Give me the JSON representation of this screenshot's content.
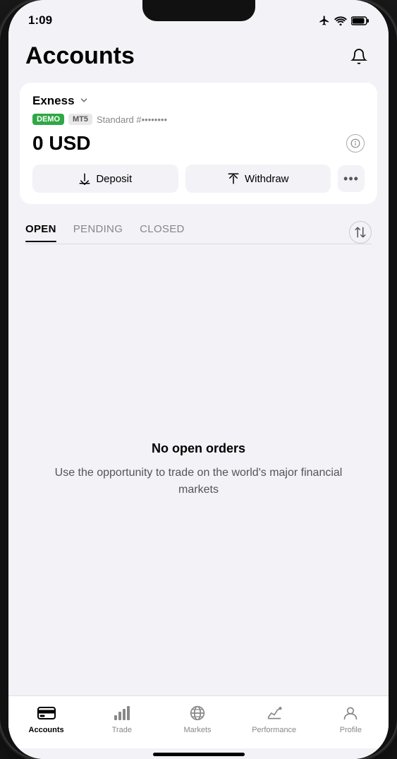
{
  "statusBar": {
    "time": "1:09",
    "icons": [
      "airplane",
      "wifi",
      "battery"
    ]
  },
  "header": {
    "title": "Accounts",
    "bellIcon": "bell"
  },
  "accountCard": {
    "brokerName": "Exness",
    "demoBadge": "DEMO",
    "mt5Badge": "MT5",
    "accountType": "Standard #••••••••",
    "balance": "0 USD",
    "depositLabel": "Deposit",
    "withdrawLabel": "Withdraw",
    "moreLabel": "•••"
  },
  "tabs": {
    "items": [
      {
        "label": "OPEN",
        "active": true
      },
      {
        "label": "PENDING",
        "active": false
      },
      {
        "label": "CLOSED",
        "active": false
      }
    ]
  },
  "emptyState": {
    "title": "No open orders",
    "subtitle": "Use the opportunity to trade on the world's major financial markets"
  },
  "bottomNav": {
    "items": [
      {
        "label": "Accounts",
        "active": true,
        "icon": "accounts"
      },
      {
        "label": "Trade",
        "active": false,
        "icon": "trade"
      },
      {
        "label": "Markets",
        "active": false,
        "icon": "markets"
      },
      {
        "label": "Performance",
        "active": false,
        "icon": "performance"
      },
      {
        "label": "Profile",
        "active": false,
        "icon": "profile"
      }
    ]
  }
}
